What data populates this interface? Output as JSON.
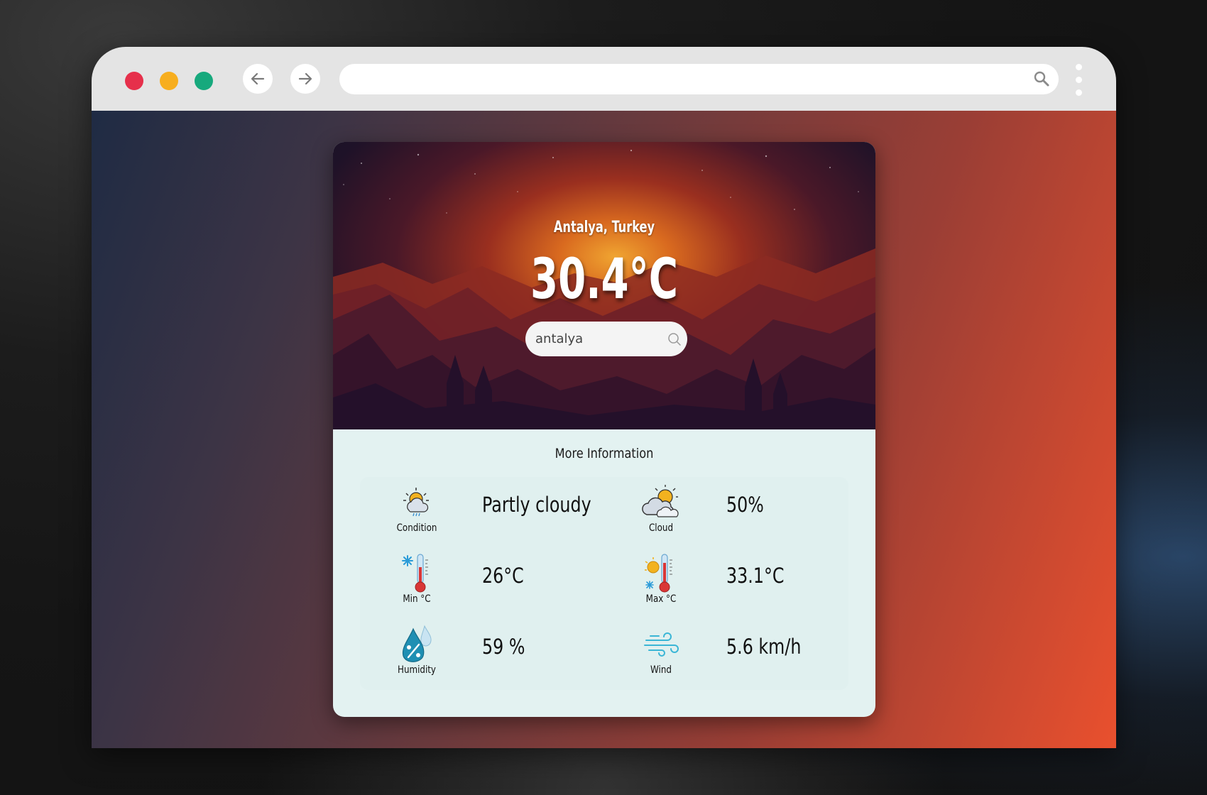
{
  "browser": {
    "address_value": "",
    "icons": [
      "back-arrow-icon",
      "forward-arrow-icon",
      "search-icon",
      "kebab-menu-icon"
    ]
  },
  "weather": {
    "location": "Antalya, Turkey",
    "temperature": "30.4°C",
    "search_value": "antalya",
    "more_info_title": "More Information",
    "details": {
      "condition": {
        "label": "Condition",
        "value": "Partly cloudy"
      },
      "cloud": {
        "label": "Cloud",
        "value": "50%"
      },
      "min": {
        "label": "Min °C",
        "value": "26°C"
      },
      "max": {
        "label": "Max °C",
        "value": "33.1°C"
      },
      "humidity": {
        "label": "Humidity",
        "value": "59 %"
      },
      "wind": {
        "label": "Wind",
        "value": "5.6 km/h"
      }
    }
  },
  "colors": {
    "close": "#e6304b",
    "minimize": "#f7ae1e",
    "maximize": "#17a97d",
    "panel": "#e3f2f1"
  }
}
